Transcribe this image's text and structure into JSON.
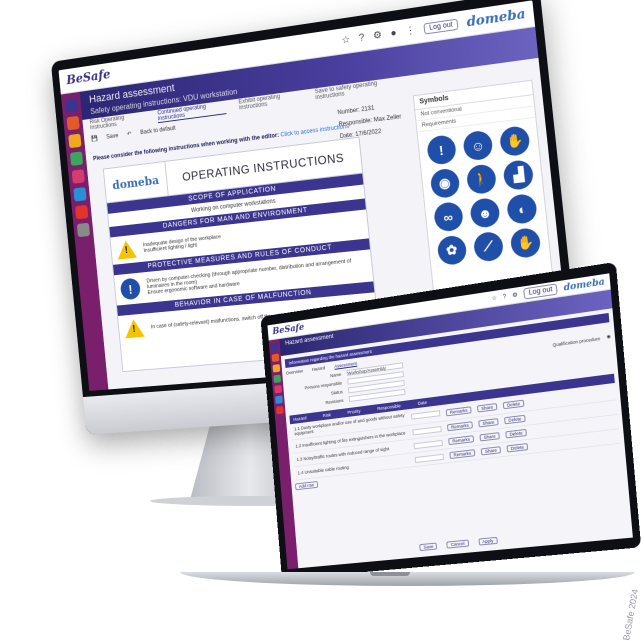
{
  "app": {
    "brand": "BeSafe",
    "brand_right": "domeba",
    "logout": "Log out"
  },
  "imac": {
    "banner_title": "Hazard assessment",
    "banner_subtitle": "Safety operating instructions: VDU workstation",
    "tabs": [
      "Risk Operating Instructions",
      "Continued operating instructions",
      "Exhibit operating instructions",
      "Save to safety operating instructions"
    ],
    "toolbar": {
      "save": "Save",
      "back": "Back to default"
    },
    "notice_prefix": "Please consider the following instructions when working with the editor:",
    "notice_link": "Click to access instructions",
    "meta": [
      {
        "label": "Number",
        "value": "2131"
      },
      {
        "label": "Responsible",
        "value": "Max Zeller"
      },
      {
        "label": "Date",
        "value": "17/6/2022"
      }
    ],
    "doc": {
      "logo": "domeba",
      "title": "OPERATING INSTRUCTIONS",
      "scope_bar": "SCOPE OF APPLICATION",
      "scope_text": "Working on computer workstations",
      "danger_bar": "DANGERS FOR MAN AND ENVIRONMENT",
      "danger_items": [
        "Inadequate design of the workplace",
        "Insufficient lighting / light"
      ],
      "protect_bar": "PROTECTIVE MEASURES AND RULES OF CONDUCT",
      "protect_items": [
        "Driven by computer-checking (through appropriate number, distribution and arrangement of luminaires in the room)",
        "Ensure ergonomic software and hardware"
      ],
      "malfunction_bar": "BEHAVIOR IN CASE OF MALFUNCTION",
      "malfunction_items": [
        "In case of (safety-relevant) malfunctions, switch off the unit and inform your supervisor."
      ]
    },
    "symbols": {
      "title": "Symbols",
      "filter": "Not conventional",
      "subfilter": "Requirements"
    }
  },
  "laptop": {
    "banner_title": "Hazard assessment",
    "section_title": "Information regarding the hazard assessment",
    "tabs": [
      "Overview",
      "Hazard",
      "Assessment"
    ],
    "form": {
      "name_label": "Name",
      "name_value": "Workshop/Assembly",
      "persons_label": "Persons responsible",
      "status_label": "Status",
      "revision_label": "Revisions",
      "qualification_label": "Qualification procedure"
    },
    "table_head": [
      "Hazard",
      "Risk",
      "Priority",
      "Responsible",
      "Date"
    ],
    "rows": [
      {
        "text": "1.1 Dusty workplace and/or use of and goods without safety equipment"
      },
      {
        "text": "1.2 Insufficient lighting of fire extinguishers in the workplace"
      },
      {
        "text": "1.3 Noisy/traffic routes with reduced range of sight"
      },
      {
        "text": "1.4 Unsuitable cable routing"
      }
    ],
    "buttons": {
      "add": "Add row",
      "remarks": "Remarks",
      "share": "Share",
      "delete": "Delete"
    },
    "footer": {
      "save": "Save",
      "cancel": "Cancel",
      "apply": "Apply"
    }
  },
  "watermark": "BeSafe 2024",
  "colors": {
    "primary": "#3c3590",
    "sidebar": "#7a1f6c",
    "mandatory_blue": "#1f4fa8",
    "warning_yellow": "#f5c400"
  }
}
